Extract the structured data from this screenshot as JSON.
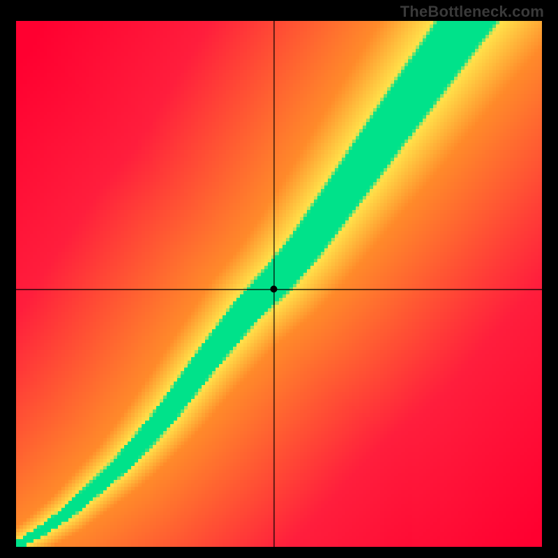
{
  "watermark": "TheBottleneck.com",
  "chart_data": {
    "type": "heatmap",
    "title": "",
    "xlabel": "",
    "ylabel": "",
    "xlim": [
      0,
      1
    ],
    "ylim": [
      0,
      1
    ],
    "grid_size": 150,
    "crosshair": {
      "x": 0.49,
      "y": 0.49
    },
    "marker": {
      "x": 0.49,
      "y": 0.49,
      "r": 5
    },
    "ridge_curve": {
      "description": "center of green band, y as function of x (normalized 0..1)",
      "points": [
        [
          0.0,
          0.0
        ],
        [
          0.05,
          0.03
        ],
        [
          0.1,
          0.065
        ],
        [
          0.15,
          0.11
        ],
        [
          0.2,
          0.155
        ],
        [
          0.25,
          0.21
        ],
        [
          0.28,
          0.245
        ],
        [
          0.3,
          0.27
        ],
        [
          0.33,
          0.31
        ],
        [
          0.36,
          0.35
        ],
        [
          0.4,
          0.4
        ],
        [
          0.44,
          0.45
        ],
        [
          0.48,
          0.49
        ],
        [
          0.5,
          0.51
        ],
        [
          0.55,
          0.57
        ],
        [
          0.6,
          0.64
        ],
        [
          0.65,
          0.71
        ],
        [
          0.7,
          0.78
        ],
        [
          0.75,
          0.85
        ],
        [
          0.8,
          0.92
        ],
        [
          0.85,
          0.99
        ],
        [
          0.865,
          1.01
        ]
      ]
    },
    "band_profile": {
      "description": "half-width of transition zone perpendicular to ridge curve, as function of arc position 0..1",
      "green_half_width": [
        0.008,
        0.06
      ],
      "yellow_half_width": [
        0.03,
        0.16
      ]
    },
    "color_stops": {
      "green": "#00E28A",
      "yellow": "#FFE24A",
      "orange": "#FF8A2A",
      "red": "#FF1E3C",
      "red_deep": "#FF0030"
    }
  }
}
